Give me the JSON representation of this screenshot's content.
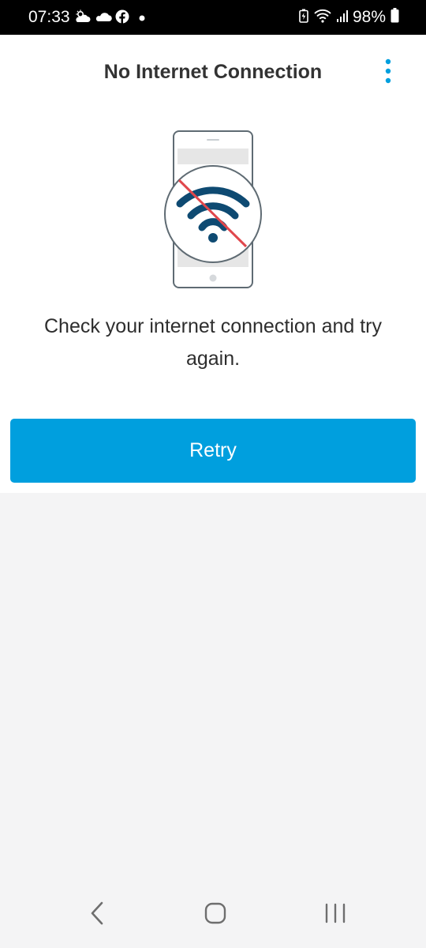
{
  "status_bar": {
    "time": "07:33",
    "battery_percent": "98%",
    "left_icons": [
      "weather-cloud-sun-icon",
      "cloud-icon",
      "facebook-icon",
      "notification-dot-icon"
    ],
    "right_icons": [
      "battery-saver-icon",
      "wifi-icon",
      "signal-icon",
      "battery-icon"
    ]
  },
  "header": {
    "title": "No Internet Connection",
    "menu_icon": "more-vertical-icon"
  },
  "illustration": {
    "icon": "no-wifi-phone-icon"
  },
  "message": "Check your internet connection and try again.",
  "actions": {
    "retry_label": "Retry"
  },
  "navigation": {
    "items": [
      "back-icon",
      "home-icon",
      "recent-apps-icon"
    ]
  },
  "colors": {
    "accent": "#009fde",
    "title_text": "#333333",
    "body_text": "#2e2e2e",
    "wifi_icon": "#0e4a72",
    "strike_line": "#e0474c",
    "background": "#f4f4f5"
  }
}
